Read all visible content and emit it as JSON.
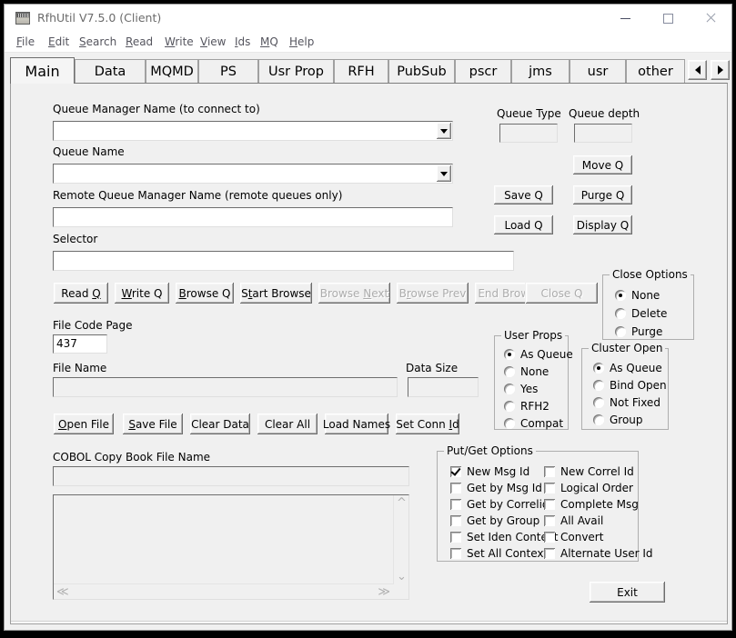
{
  "window": {
    "title": "RfhUtil V7.5.0 (Client)",
    "icon": "app-icon",
    "minimize": "minimize-icon",
    "maximize": "maximize-icon",
    "close": "close-icon"
  },
  "menu": {
    "items": [
      {
        "label": "File",
        "accel": "F"
      },
      {
        "label": "Edit",
        "accel": "E"
      },
      {
        "label": "Search",
        "accel": "S"
      },
      {
        "label": "Read",
        "accel": "R"
      },
      {
        "label": "Write",
        "accel": "W"
      },
      {
        "label": "View",
        "accel": "V"
      },
      {
        "label": "Ids",
        "accel": "I"
      },
      {
        "label": "MQ",
        "accel": "M"
      },
      {
        "label": "Help",
        "accel": "H"
      }
    ]
  },
  "tabs": {
    "items": [
      {
        "label": "Main",
        "selected": true
      },
      {
        "label": "Data",
        "selected": false
      },
      {
        "label": "MQMD",
        "selected": false
      },
      {
        "label": "PS",
        "selected": false
      },
      {
        "label": "Usr Prop",
        "selected": false
      },
      {
        "label": "RFH",
        "selected": false
      },
      {
        "label": "PubSub",
        "selected": false
      },
      {
        "label": "pscr",
        "selected": false
      },
      {
        "label": "jms",
        "selected": false
      },
      {
        "label": "usr",
        "selected": false
      },
      {
        "label": "other",
        "selected": false
      }
    ],
    "scroll_left": "scroll-left-icon",
    "scroll_right": "scroll-right-icon"
  },
  "main": {
    "queue_manager_label": "Queue Manager Name (to connect to)",
    "queue_manager_value": "",
    "queue_name_label": "Queue Name",
    "queue_name_value": "",
    "remote_qm_label": "Remote Queue Manager Name (remote queues only)",
    "remote_qm_value": "",
    "selector_label": "Selector",
    "selector_value": "",
    "queue_type_label": "Queue Type",
    "queue_type_value": "",
    "queue_depth_label": "Queue depth",
    "queue_depth_value": "",
    "file_code_page_label": "File Code Page",
    "file_code_page_value": "437",
    "file_name_label": "File Name",
    "file_name_value": "",
    "data_size_label": "Data Size",
    "data_size_value": "",
    "cobol_label": "COBOL Copy Book File Name",
    "cobol_value": "",
    "memo_value": ""
  },
  "queue_buttons": {
    "move_q": {
      "label": "Move Q",
      "accel": "",
      "enabled": true
    },
    "save_q": {
      "label": "Save Q",
      "accel": "",
      "enabled": true
    },
    "purge_q": {
      "label": "Purge Q",
      "accel": "g",
      "enabled": true
    },
    "load_q": {
      "label": "Load Q",
      "accel": "L",
      "enabled": true
    },
    "display_q": {
      "label": "Display Q",
      "accel": "D",
      "enabled": true
    }
  },
  "action_buttons": [
    {
      "label": "Read Q",
      "accel": "Q",
      "enabled": true
    },
    {
      "label": "Write Q",
      "accel": "W",
      "enabled": true
    },
    {
      "label": "Browse Q",
      "accel": "B",
      "enabled": true
    },
    {
      "label": "Start Browse",
      "accel": "t",
      "enabled": true
    },
    {
      "label": "Browse Next",
      "accel": "N",
      "enabled": false
    },
    {
      "label": "Browse Prev",
      "accel": "r",
      "enabled": false
    },
    {
      "label": "End Browse",
      "accel": "",
      "enabled": false
    },
    {
      "label": "Close Q",
      "accel": "",
      "enabled": false
    }
  ],
  "file_buttons": [
    {
      "label": "Open File",
      "accel": "O",
      "enabled": true
    },
    {
      "label": "Save File",
      "accel": "S",
      "enabled": true
    },
    {
      "label": "Clear Data",
      "accel": "",
      "enabled": true
    },
    {
      "label": "Clear All",
      "accel": "",
      "enabled": true
    },
    {
      "label": "Load Names",
      "accel": "",
      "enabled": true
    },
    {
      "label": "Set Conn Id",
      "accel": "I",
      "enabled": true
    }
  ],
  "close_options": {
    "title": "Close Options",
    "items": [
      {
        "label": "None",
        "selected": true
      },
      {
        "label": "Delete",
        "selected": false
      },
      {
        "label": "Purge",
        "selected": false
      }
    ]
  },
  "user_props": {
    "title": "User Props",
    "items": [
      {
        "label": "As Queue",
        "selected": true
      },
      {
        "label": "None",
        "selected": false
      },
      {
        "label": "Yes",
        "selected": false
      },
      {
        "label": "RFH2",
        "selected": false
      },
      {
        "label": "Compat",
        "selected": false
      }
    ]
  },
  "cluster_open": {
    "title": "Cluster Open",
    "items": [
      {
        "label": "As Queue",
        "selected": true
      },
      {
        "label": "Bind Open",
        "selected": false
      },
      {
        "label": "Not Fixed",
        "selected": false
      },
      {
        "label": "Group",
        "selected": false
      }
    ]
  },
  "put_get_options": {
    "title": "Put/Get Options",
    "left_column": [
      {
        "label": "New Msg Id",
        "checked": true
      },
      {
        "label": "Get by Msg Id",
        "checked": false
      },
      {
        "label": "Get by Correlid",
        "checked": false
      },
      {
        "label": "Get by Group Id",
        "checked": false
      },
      {
        "label": "Set Iden Context",
        "checked": false
      },
      {
        "label": "Set All Context",
        "checked": false
      }
    ],
    "right_column": [
      {
        "label": "New Correl Id",
        "checked": false
      },
      {
        "label": "Logical Order",
        "checked": false
      },
      {
        "label": "Complete Msg",
        "checked": false
      },
      {
        "label": "All Avail",
        "checked": false
      },
      {
        "label": "Convert",
        "checked": false
      },
      {
        "label": "Alternate User Id",
        "checked": false
      }
    ]
  },
  "exit_button": {
    "label": "Exit"
  },
  "colors": {
    "window_background": "#f0f0f0",
    "field_background": "#ffffff",
    "frame": "#000000",
    "title_text": "#6b6b6b",
    "menu_text": "#55555e",
    "disabled_text": "#adadad"
  }
}
